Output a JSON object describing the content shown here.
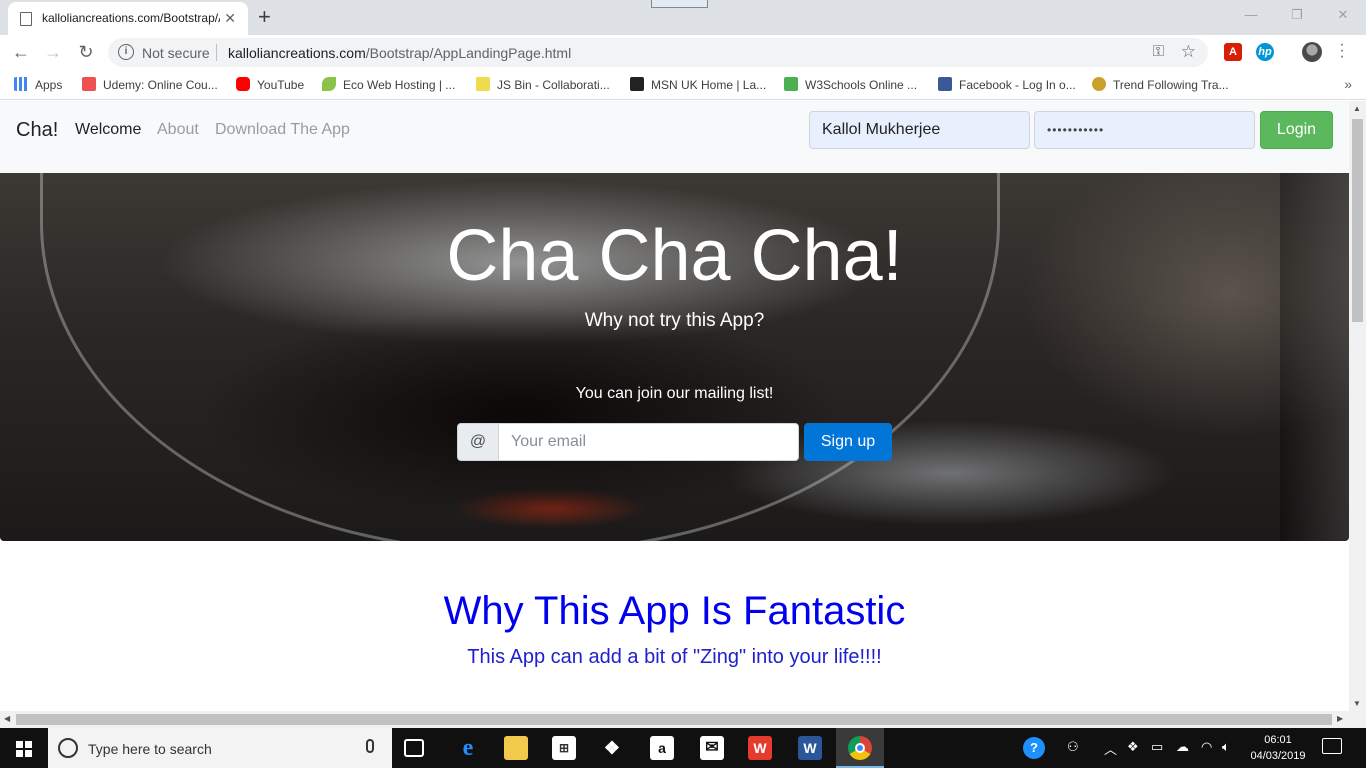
{
  "browser": {
    "tab_title": "kalloliancreations.com/Bootstrap/AppLandingPage.html",
    "security_label": "Not secure",
    "url_host": "kalloliancreations.com",
    "url_path": "/Bootstrap/AppLandingPage.html",
    "bookmarks": [
      {
        "label": "Apps",
        "color": "#4285f4"
      },
      {
        "label": "Udemy: Online Cou...",
        "color": "#ec5252"
      },
      {
        "label": "YouTube",
        "color": "#ff0000"
      },
      {
        "label": "Eco Web Hosting | ...",
        "color": "#8bc34a"
      },
      {
        "label": "JS Bin - Collaborati...",
        "color": "#f0db4f"
      },
      {
        "label": "MSN UK Home | La...",
        "color": "#222222"
      },
      {
        "label": "W3Schools Online ...",
        "color": "#4caf50"
      },
      {
        "label": "Facebook - Log In o...",
        "color": "#3b5998"
      },
      {
        "label": "Trend Following Tra...",
        "color": "#c8a02a"
      }
    ]
  },
  "site": {
    "brand": "Cha!",
    "nav": [
      "Welcome",
      "About",
      "Download The App"
    ],
    "username_value": "Kallol Mukherjee",
    "password_value": "•••••••••••",
    "login_label": "Login",
    "accent_login": "#5cb85c",
    "accent_signup": "#0275d8"
  },
  "hero": {
    "title": "Cha Cha Cha!",
    "subtitle": "Why not try this App?",
    "join_text": "You can join our mailing list!",
    "email_prefix": "@",
    "email_placeholder": "Your email",
    "signup_label": "Sign up"
  },
  "features": {
    "title": "Why This App Is Fantastic",
    "subtitle": "This App can add a bit of \"Zing\" into your life!!!!"
  },
  "taskbar": {
    "search_placeholder": "Type here to search",
    "time": "06:01",
    "date": "04/03/2019"
  }
}
